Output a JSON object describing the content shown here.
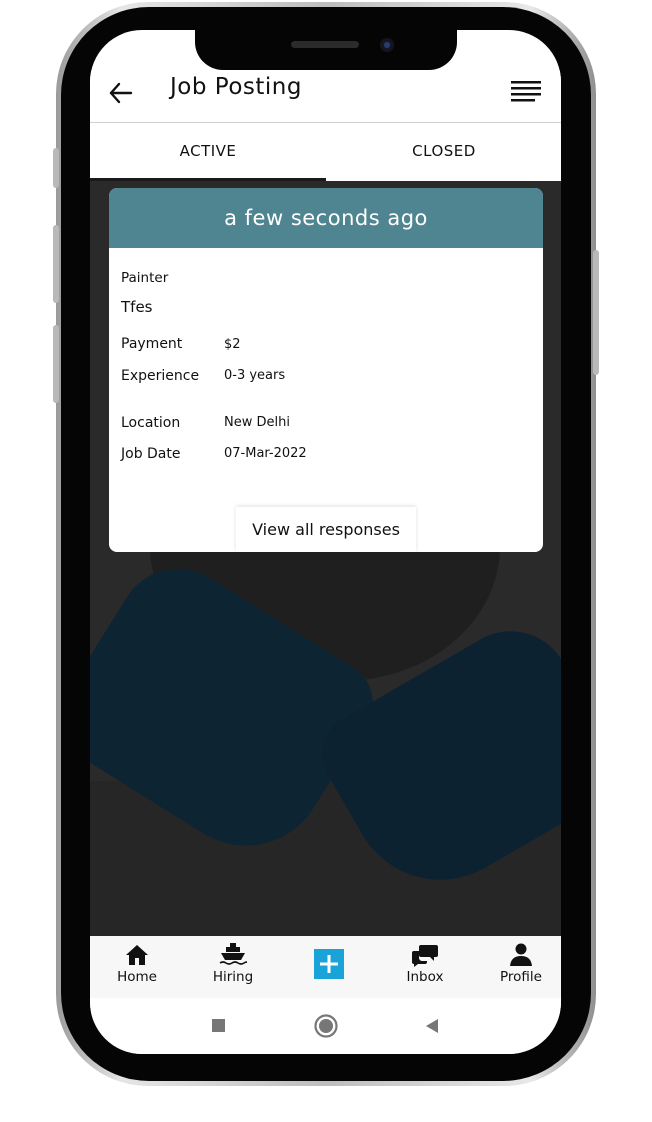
{
  "header": {
    "title": "Job Posting",
    "back_icon": "arrow-left-icon",
    "menu_icon": "menu-lines-icon"
  },
  "tabs": [
    {
      "label": "ACTIVE",
      "selected": true
    },
    {
      "label": "CLOSED",
      "selected": false
    }
  ],
  "card": {
    "time_ago": "a few seconds ago",
    "category": "Painter",
    "job_title": "Tfes",
    "fields": [
      {
        "label": "Payment",
        "value": "$2"
      },
      {
        "label": "Experience",
        "value": "0-3 years"
      },
      {
        "label": "Location",
        "value": "New Delhi"
      },
      {
        "label": "Job Date",
        "value": "07-Mar-2022"
      }
    ],
    "responses_button": "View all responses",
    "header_color": "#4f8591"
  },
  "bottom_nav": [
    {
      "label": "Home",
      "icon": "home-icon"
    },
    {
      "label": "Hiring",
      "icon": "ship-icon"
    },
    {
      "label": "",
      "icon": "add-icon"
    },
    {
      "label": "Inbox",
      "icon": "chat-bubbles-icon"
    },
    {
      "label": "Profile",
      "icon": "person-icon"
    }
  ],
  "system_nav": {
    "icons": [
      "square-icon",
      "circle-icon",
      "triangle-back-icon"
    ]
  },
  "colors": {
    "accent": "#1aa3d9",
    "card_header": "#4f8591"
  }
}
